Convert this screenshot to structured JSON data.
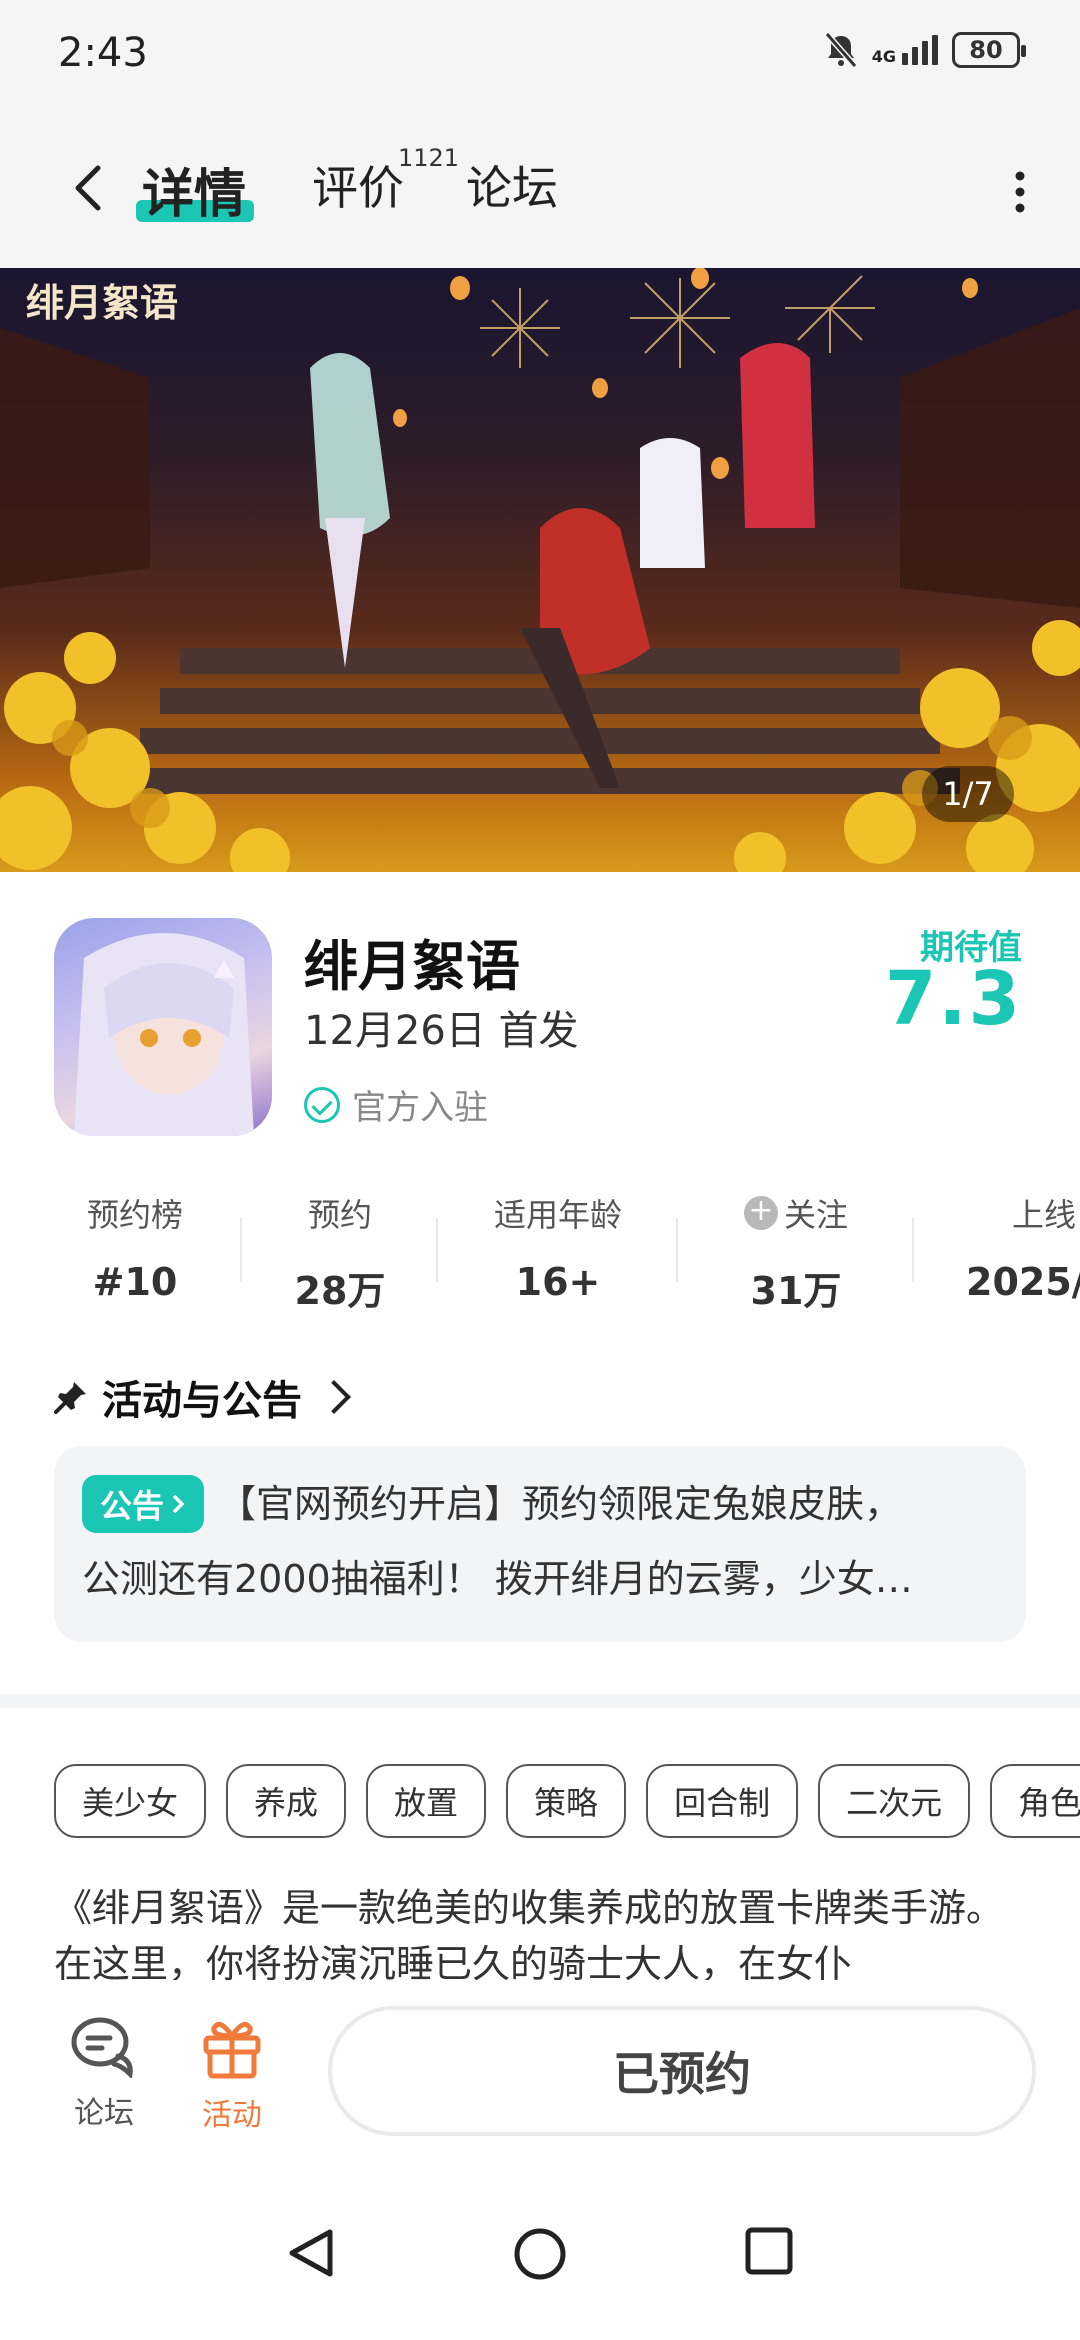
{
  "status": {
    "time": "2:43",
    "network": "4G",
    "battery": "80"
  },
  "nav": {
    "tabs": [
      {
        "label": "详情"
      },
      {
        "label": "评价",
        "count": "1121"
      },
      {
        "label": "论坛"
      }
    ]
  },
  "banner": {
    "indicator": "1/7",
    "logo_text": "绯月絮语"
  },
  "app": {
    "name": "绯月絮语",
    "release": "12月26日 首发",
    "official": "官方入驻",
    "expect_label": "期待值",
    "expect_value": "7.3"
  },
  "stats": [
    {
      "label": "预约榜",
      "value": "#10"
    },
    {
      "label": "预约",
      "value": "28万"
    },
    {
      "label": "适用年龄",
      "value": "16+"
    },
    {
      "label": "关注",
      "value": "31万"
    },
    {
      "label": "上线",
      "value": "2025/"
    }
  ],
  "activity": {
    "title": "活动与公告",
    "badge": "公告",
    "line1": "【官网预约开启】预约领限定兔娘皮肤，",
    "line2": "公测还有2000抽福利！ 拨开绯月的云雾，少女…"
  },
  "tags": [
    "美少女",
    "养成",
    "放置",
    "策略",
    "回合制",
    "二次元",
    "角色"
  ],
  "description": "《绯月絮语》是一款绝美的收集养成的放置卡牌类手游。在这里，你将扮演沉睡已久的骑士大人，在女仆",
  "bottom": {
    "forum": "论坛",
    "activity": "活动",
    "reserve": "已预约"
  },
  "colors": {
    "accent": "#1bc6b4",
    "activity": "#f07a3a"
  }
}
